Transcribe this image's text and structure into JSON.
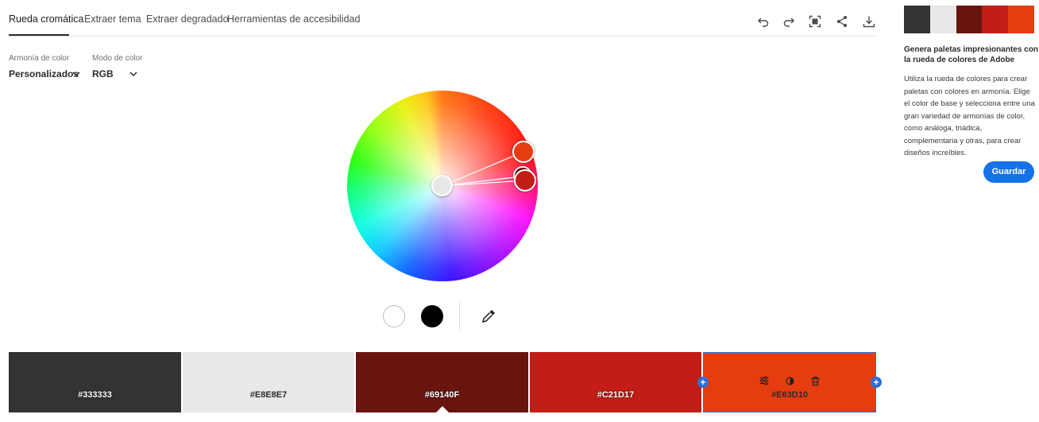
{
  "tabs": [
    {
      "label": "Rueda cromática",
      "active": true
    },
    {
      "label": "Extraer tema",
      "active": false
    },
    {
      "label": "Extraer degradado",
      "active": false
    },
    {
      "label": "Herramientas de accesibilidad",
      "active": false
    }
  ],
  "toolbar": [
    "undo-icon",
    "redo-icon",
    "fit-screen-icon",
    "share-icon",
    "download-icon"
  ],
  "harmony": {
    "label": "Armonía de color",
    "value": "Personalizados"
  },
  "mode": {
    "label": "Modo de color",
    "value": "RGB"
  },
  "wheel_handles": [
    {
      "color": "#e8e8e7",
      "role": "base"
    },
    {
      "color": "#e63d10"
    },
    {
      "color": "#69140f"
    },
    {
      "color": "#c21d17"
    }
  ],
  "swatches": [
    {
      "hex": "#333333",
      "label": "#333333",
      "text_color": "#ffffff",
      "text_shadow": true
    },
    {
      "hex": "#E8E8E7",
      "label": "#E8E8E7",
      "text_color": "#2c2c2c",
      "text_shadow": false
    },
    {
      "hex": "#69140F",
      "label": "#69140F",
      "text_color": "#ffffff",
      "text_shadow": true,
      "base": true
    },
    {
      "hex": "#C21D17",
      "label": "#C21D17",
      "text_color": "#ffffff",
      "text_shadow": true
    },
    {
      "hex": "#E63D10",
      "label": "#E63D10",
      "text_color": "#2c2c2c",
      "text_shadow": false,
      "selected": true
    }
  ],
  "swatch_tools": [
    "sliders-icon",
    "contrast-icon",
    "trash-icon"
  ],
  "sidebar": {
    "palette": [
      "#333333",
      "#E8E8E7",
      "#69140F",
      "#C21D17",
      "#E63D10"
    ],
    "title": "Genera paletas impresionantes con la rueda de colores de Adobe",
    "body": "Utiliza la rueda de colores para crear paletas con colores en armonía. Elige el color de base y selecciona entre una gran variedad de armonías de color, como análoga, triádica, complementaria y otras, para crear diseños increíbles.",
    "save_label": "Guardar"
  }
}
